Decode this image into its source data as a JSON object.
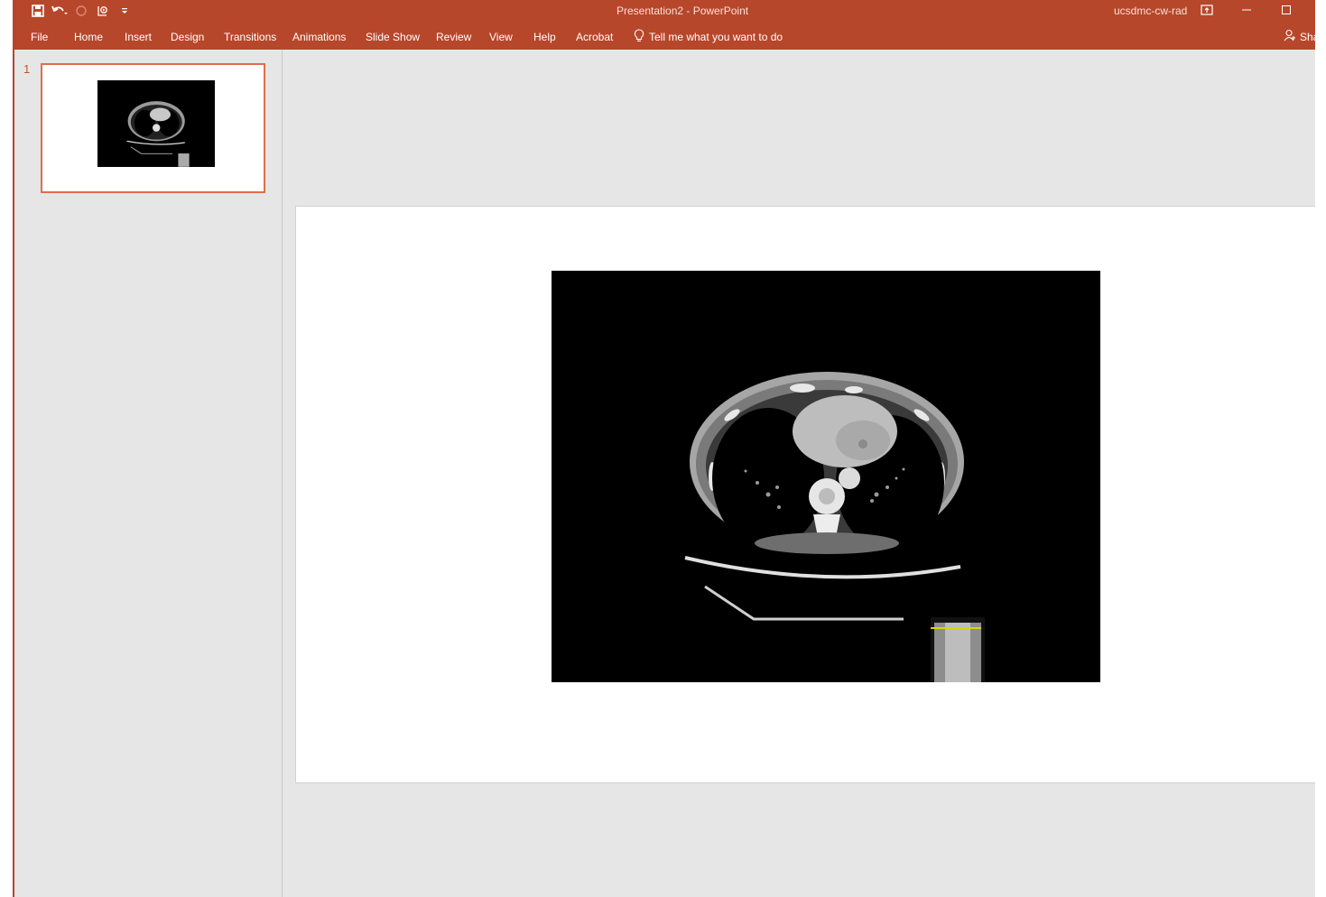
{
  "window": {
    "title": "Presentation2  -  PowerPoint",
    "user": "ucsdmc-cw-rad"
  },
  "quick_access": {
    "icons": [
      "save-icon",
      "undo-icon",
      "redo-icon",
      "start-from-beginning-icon",
      "customize-toolbar-icon"
    ]
  },
  "ribbon": {
    "tabs": [
      "File",
      "Home",
      "Insert",
      "Design",
      "Transitions",
      "Animations",
      "Slide Show",
      "Review",
      "View",
      "Help",
      "Acrobat"
    ],
    "tell_me": "Tell me what you want to do",
    "share": "Sha"
  },
  "thumbnails": [
    {
      "number": "1",
      "selected": true
    }
  ],
  "colors": {
    "accent": "#b7472a",
    "thumb_selected_border": "#e46c4a",
    "pane_background": "#e6e6e6"
  }
}
